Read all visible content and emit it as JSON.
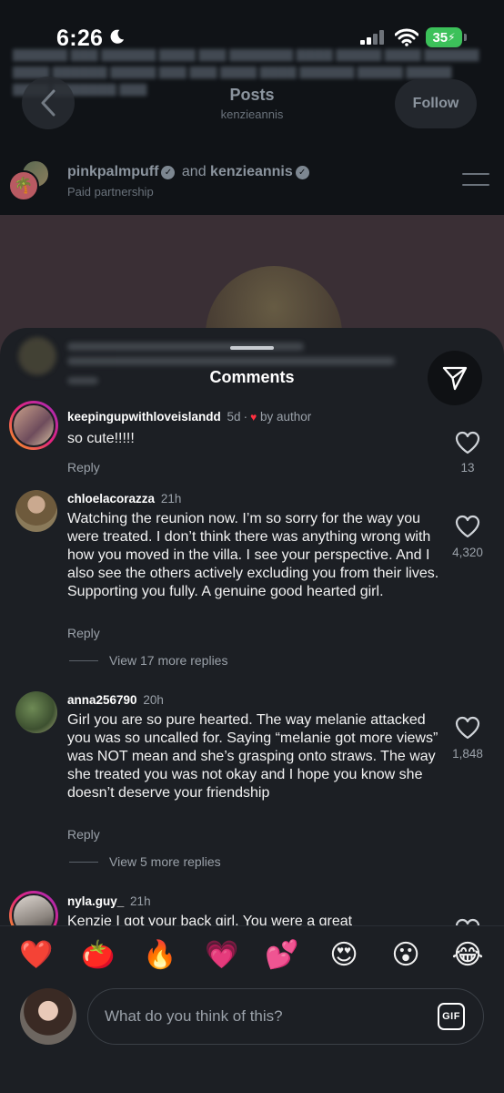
{
  "status": {
    "time": "6:26",
    "battery": "35"
  },
  "header": {
    "title": "Posts",
    "subtitle": "kenzieannis",
    "follow_label": "Follow"
  },
  "post": {
    "author1": "pinkpalmpuff",
    "joiner": "and",
    "author2": "kenzieannis",
    "label": "Paid partnership"
  },
  "sheet": {
    "title": "Comments"
  },
  "comments": [
    {
      "user": "keepingupwithloveislandd",
      "time": "5d",
      "author_badge": "by author",
      "text": "so cute!!!!!",
      "reply": "Reply",
      "likes": "13"
    },
    {
      "user": "chloelacorazza",
      "time": "21h",
      "text": "Watching the reunion now. I’m so sorry for the way you were treated. I don’t think there was anything wrong with how you moved in the villa. I see your perspective. And I also see the others actively excluding you from their lives. Supporting you fully. A genuine good hearted girl.",
      "reply": "Reply",
      "likes": "4,320",
      "view_more": "View 17 more replies"
    },
    {
      "user": "anna256790",
      "time": "20h",
      "text": "Girl you are so pure hearted. The way melanie attacked you was so uncalled for. Saying “melanie got more views” was NOT mean and she’s grasping onto straws. The way she treated you was not okay and I hope you know she doesn’t deserve your friendship",
      "reply": "Reply",
      "likes": "1,848",
      "view_more": "View 5 more replies"
    },
    {
      "user": "nyla.guy_",
      "time": "21h",
      "text": "Kenzie I got your back girl. You were a great"
    }
  ],
  "emojis": [
    "❤️",
    "🍅",
    "🔥",
    "💗",
    "💕",
    "😍",
    "😮",
    "😂"
  ],
  "composer": {
    "placeholder": "What do you think of this?",
    "gif_label": "GIF"
  },
  "colors": {
    "like_red": "#ff3040",
    "battery_green": "#3cc15a",
    "sheet_bg": "#1c1f24"
  }
}
